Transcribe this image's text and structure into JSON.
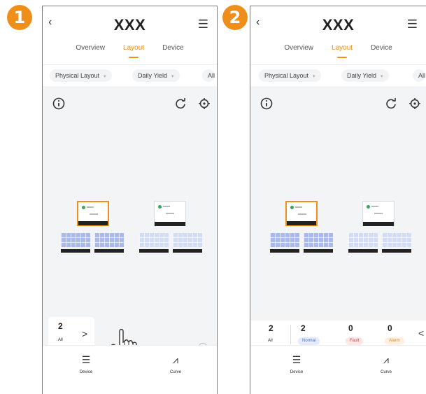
{
  "steps": [
    "1",
    "2"
  ],
  "app_title": "XXX",
  "tabs": [
    {
      "label": "Overview",
      "active": false
    },
    {
      "label": "Layout",
      "active": true
    },
    {
      "label": "Device",
      "active": false
    }
  ],
  "filters": [
    {
      "label": "Physical Layout"
    },
    {
      "label": "Daily Yield"
    },
    {
      "label": "All"
    }
  ],
  "summary": {
    "all_count": "2",
    "all_label": "All",
    "normal_count": "2",
    "normal_label": "Normal",
    "fault_count": "0",
    "fault_label": "Fault",
    "alarm_count": "0",
    "alarm_label": "Alarm",
    "expand_arrow": ">",
    "collapse_arrow": "<"
  },
  "help_mark": "?",
  "bottom_nav": [
    {
      "label": "Device",
      "icon": "device-icon"
    },
    {
      "label": "Curve",
      "icon": "curve-icon"
    }
  ],
  "colors": {
    "accent": "#ef8f1b",
    "online": "#3aa55d",
    "panel": "#a9b9e8",
    "normal": "#4a6fc7",
    "fault": "#d24242",
    "alarm": "#e08a1e"
  }
}
